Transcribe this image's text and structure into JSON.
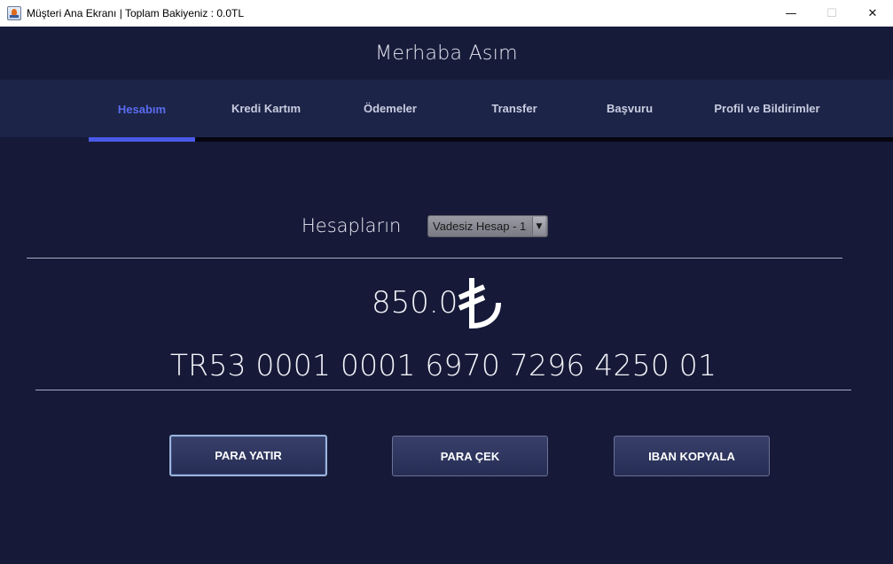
{
  "window": {
    "title": "Müşteri Ana Ekranı | Toplam Bakiyeniz : 0.0TL",
    "icon": "java-icon",
    "controls": {
      "minimize": "—",
      "maximize": "☐",
      "close": "✕"
    }
  },
  "header": {
    "greeting": "Merhaba Asım"
  },
  "tabs": [
    {
      "label": "Hesabım",
      "active": true
    },
    {
      "label": "Kredi Kartım"
    },
    {
      "label": "Ödemeler"
    },
    {
      "label": "Transfer"
    },
    {
      "label": "Başvuru"
    },
    {
      "label": "Profil ve Bildirimler"
    }
  ],
  "account": {
    "label": "Hesapların",
    "selected": "Vadesiz Hesap - 1",
    "balance": "850.0",
    "currency_icon": "turkish-lira-icon",
    "iban": "TR53 0001 0001 6970 7296 4250 01"
  },
  "actions": {
    "deposit": "PARA YATIR",
    "withdraw": "PARA ÇEK",
    "copy_iban": "IBAN KOPYALA"
  },
  "colors": {
    "background": "#161a38",
    "tabbar": "#1c2448",
    "active_tab": "#5a6cf0",
    "button": "#2e365f"
  }
}
